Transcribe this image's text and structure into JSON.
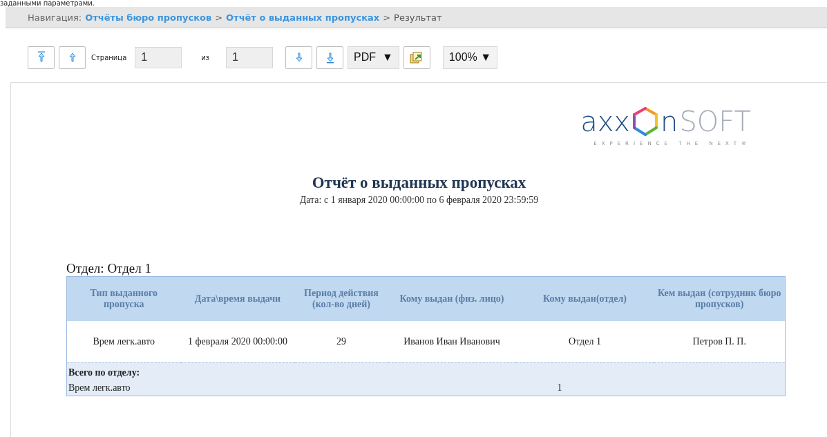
{
  "caption_above": "заданными параметрами.",
  "breadcrumb": {
    "label": "Навигация:",
    "separator": ">",
    "items": [
      {
        "text": "Отчёты бюро пропусков",
        "kind": "link"
      },
      {
        "text": "Отчёт о выданных пропусках",
        "kind": "link"
      },
      {
        "text": "Результат",
        "kind": "current"
      }
    ]
  },
  "toolbar": {
    "page_label": "Страница",
    "page_value": "1",
    "of_label": "из",
    "total_value": "1",
    "format": "PDF",
    "format_arrow": "▼",
    "zoom": "100%",
    "zoom_arrow": "▼"
  },
  "report": {
    "logo": {
      "left": "axx",
      "right": "n",
      "suffix": "SOFT",
      "tagline": "EXPERIENCE THE NEXT®"
    },
    "title": "Отчёт о выданных пропусках",
    "subtitle": "Дата: с 1 января 2020 00:00:00 по 6 февраля 2020 23:59:59",
    "group_title": "Отдел: Отдел 1",
    "table": {
      "columns": [
        "Тип выданного пропуска",
        "Дата\\время выдачи",
        "Период действия (кол-во дней)",
        "Кому выдан (физ. лицо)",
        "Кому выдан(отдел)",
        "Кем выдан (сотрудник бюро пропусков)"
      ],
      "rows": [
        [
          "Врем легк.авто",
          "1 февраля 2020 00:00:00",
          "29",
          "Иванов Иван Иванович",
          "Отдел 1",
          "Петров П. П."
        ]
      ],
      "summary_title": "Всего по отделу:",
      "summary_rows": [
        {
          "type": "Врем легк.авто",
          "count": "1"
        }
      ]
    }
  }
}
